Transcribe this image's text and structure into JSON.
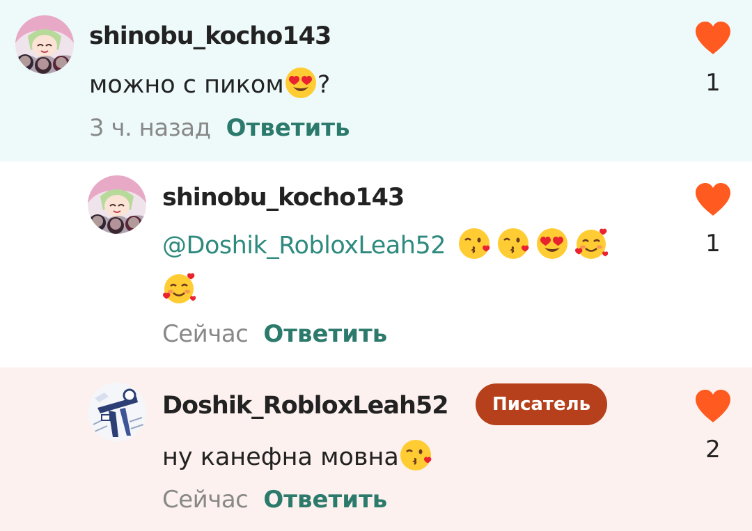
{
  "colors": {
    "highlight_bg": "#eefafa",
    "author_bg": "#fcf1ee",
    "heart": "#ff5a1f",
    "reply": "#2c7a6c",
    "mention": "#2e8a7e",
    "badge": "#b5401b"
  },
  "comments": [
    {
      "username": "shinobu_kocho143",
      "text": "можно с пиком",
      "trailing_text": "?",
      "emojis": [
        "heart-eyes-emoji"
      ],
      "time": "3 ч. назад",
      "reply_label": "Ответить",
      "likes": "1"
    },
    {
      "username": "shinobu_kocho143",
      "mention": "@Doshik_RobloxLeah52",
      "emojis": [
        "kissing-heart-emoji",
        "kissing-heart-emoji",
        "heart-eyes-emoji",
        "smiling-hearts-emoji",
        "smiling-hearts-emoji"
      ],
      "time": "Сейчас",
      "reply_label": "Ответить",
      "likes": "1"
    },
    {
      "username": "Doshik_RobloxLeah52",
      "badge": "Писатель",
      "text": "ну канефна мовна",
      "emojis": [
        "kissing-heart-emoji"
      ],
      "time": "Сейчас",
      "reply_label": "Ответить",
      "likes": "2"
    }
  ]
}
